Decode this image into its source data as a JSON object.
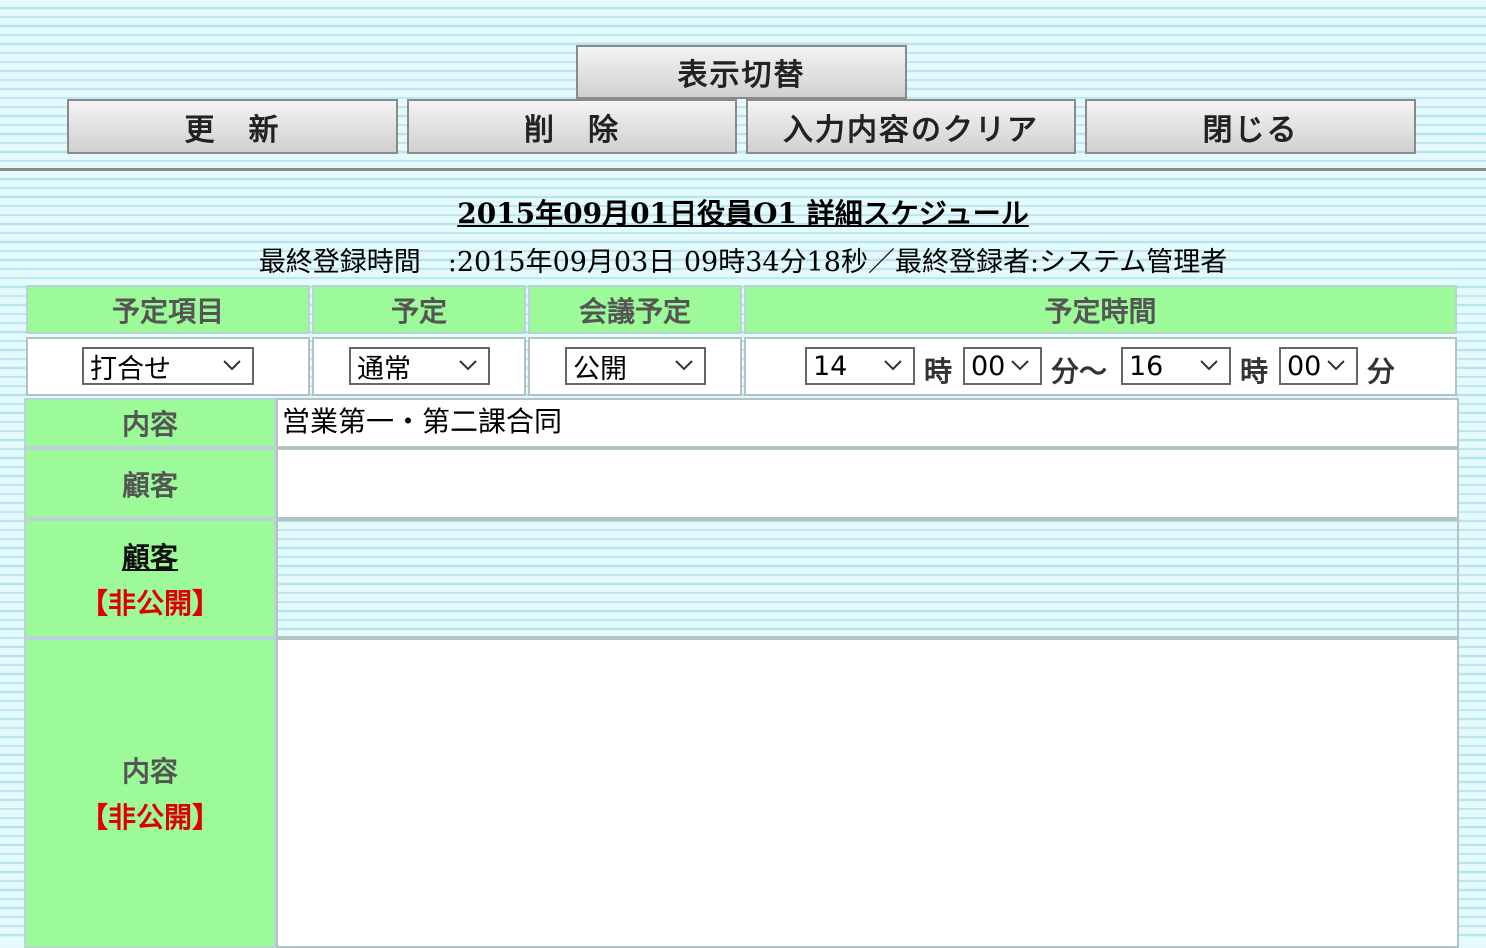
{
  "buttons": {
    "toggle": "表示切替",
    "update": "更　新",
    "delete": "削　除",
    "clear": "入力内容のクリア",
    "close": "閉じる"
  },
  "title": "2015年09月01日役員O1 詳細スケジュール",
  "meta": "最終登録時間　:2015年09月03日 09時34分18秒／最終登録者:システム管理者",
  "headers": {
    "item": "予定項目",
    "type": "予定",
    "meeting": "会議予定",
    "time": "予定時間"
  },
  "selects": {
    "item": "打合せ",
    "type": "通常",
    "meeting": "公開",
    "start_hour": "14",
    "start_min": "00",
    "end_hour": "16",
    "end_min": "00"
  },
  "units": {
    "hour": "時",
    "min_range": "分～",
    "min": "分"
  },
  "rows": {
    "content_label": "内容",
    "content_value": "営業第一・第二課合同",
    "customer_label": "顧客",
    "customer_value": "",
    "private_customer_label": "顧客",
    "private_tag": "【非公開】",
    "private_content_label": "内容",
    "private_content_tag": "【非公開】"
  }
}
